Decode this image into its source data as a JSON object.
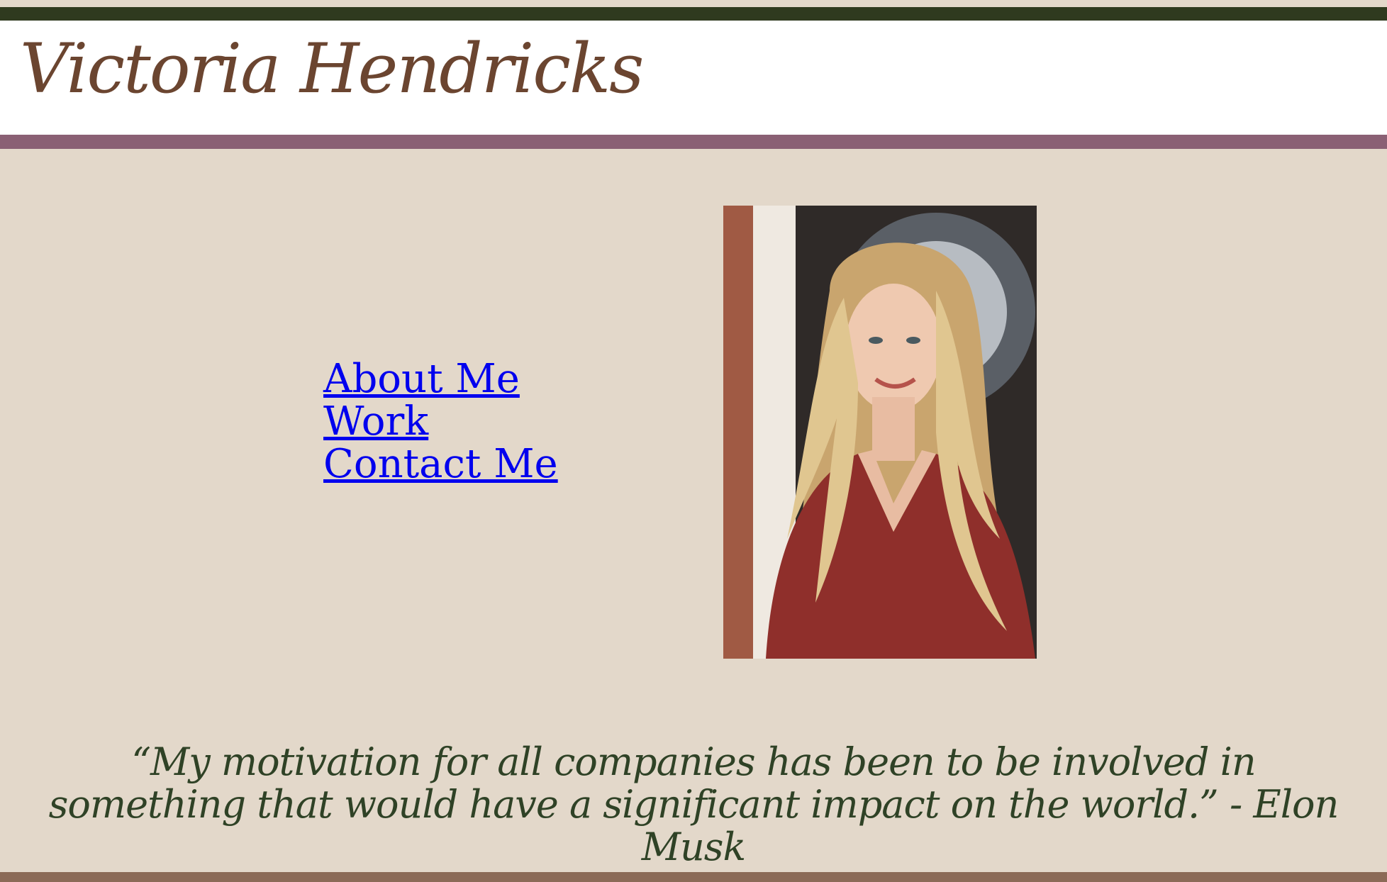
{
  "header": {
    "site_title": "Victoria Hendricks"
  },
  "nav": {
    "items": [
      {
        "label": "About Me"
      },
      {
        "label": "Work"
      },
      {
        "label": "Contact Me"
      }
    ]
  },
  "portrait": {
    "alt": "Portrait of Victoria Hendricks"
  },
  "quote": {
    "text": "“My motivation for all companies has been to be involved in something that would have a significant impact on the world.” - Elon Musk"
  },
  "colors": {
    "background": "#e3d8ca",
    "top_bar": "#2f3a1f",
    "header_rule": "#8a6074",
    "title": "#6b4530",
    "quote": "#2f4226",
    "link": "#0000ee",
    "bottom_rule": "#8b6a57"
  }
}
